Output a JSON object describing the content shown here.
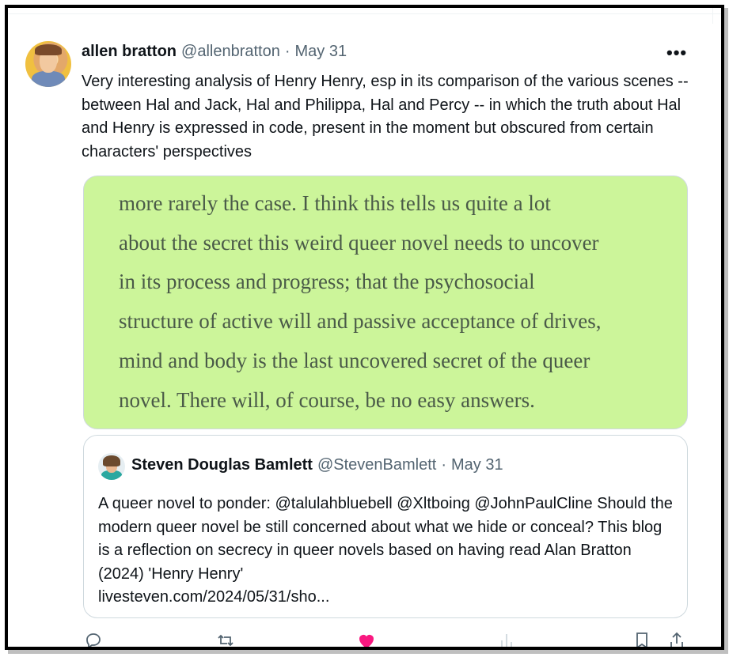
{
  "tweet": {
    "author_name": "allen bratton",
    "author_handle": "@allenbratton",
    "separator": "·",
    "date": "May 31",
    "more_label": "•••",
    "text": "Very interesting analysis of Henry Henry, esp in its comparison of the various scenes -- between Hal and Jack, Hal and Philippa, Hal and Percy -- in which the truth about Hal and Henry is expressed in code, present in the moment but obscured from certain characters' perspectives"
  },
  "media": {
    "background_color": "#ccf59a",
    "lines": [
      "more rarely the case. I think this tells us quite a lot",
      "about the secret this weird queer novel needs to uncover",
      "in its process and progress; that the psychosocial",
      "structure of active will and passive acceptance of drives,",
      "mind and body is the last uncovered secret of the queer",
      "novel. There will, of course, be no easy answers."
    ]
  },
  "quote": {
    "author_name": "Steven Douglas Bamlett",
    "author_handle": "@StevenBamlett",
    "separator": "·",
    "date": "May 31",
    "text": "A queer novel to ponder: @talulahbluebell @Xltboing @JohnPaulCline Should the modern queer novel be still concerned about what we hide or conceal? This blog is a reflection on secrecy in queer novels based on having read Alan Bratton (2024) 'Henry Henry'",
    "link": "livesteven.com/2024/05/31/sho..."
  },
  "actions": {
    "reply_icon": "reply-icon",
    "retweet_icon": "retweet-icon",
    "like_icon": "heart-icon",
    "views_icon": "views-icon",
    "bookmark_icon": "bookmark-icon",
    "share_icon": "share-icon",
    "like_color": "#f91880"
  }
}
